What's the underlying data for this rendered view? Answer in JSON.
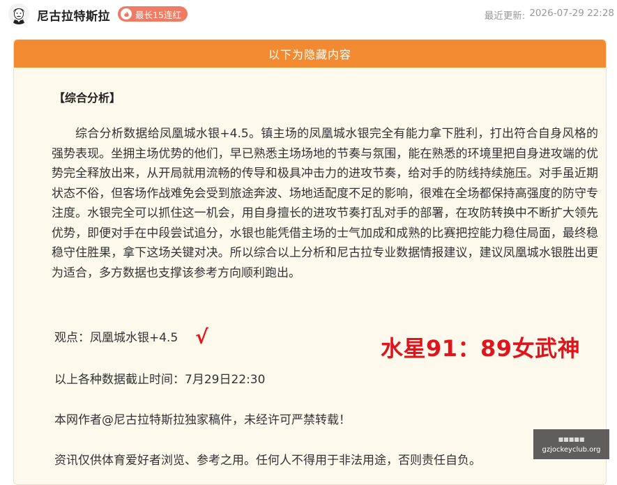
{
  "header": {
    "author_name": "尼古拉特斯拉",
    "streak_badge": "最长15连红",
    "updated_label": "最近更新:",
    "updated_time": "2026-07-29 22:28"
  },
  "card": {
    "hidden_banner": "以下为隐藏内容",
    "section_title": "【综合分析】",
    "analysis_paragraph": "综合分析数据给凤凰城水银+4.5。镇主场的凤凰城水银完全有能力拿下胜利，打出符合自身风格的强势表现。坐拥主场优势的他们，早已熟悉主场场地的节奏与氛围，能在熟悉的环境里把自身进攻端的优势完全释放出来，从开局就用流畅的传导和极具冲击力的进攻节奏，给对手的防线持续施压。对手虽近期状态不俗，但客场作战难免会受到旅途奔波、场地适配度不足的影响，很难在全场都保持高强度的防守专注度。水银完全可以抓住这一机会，用自身擅长的进攻节奏打乱对手的部署，在攻防转换中不断扩大领先优势，即便对手在中段尝试追分，水银也能凭借主场的士气加成和成熟的比赛把控能力稳住局面，最终稳稳守住胜果，拿下这场关键对决。所以综合以上分析和尼古拉专业数据情报建议，建议凤凰城水银胜出更为适合，多方数据也支撑该参考方向顺利跑出。",
    "viewpoint": "观点：凤凰城水银+4.5",
    "check_mark": "√",
    "result_score": "水星91：89女武神",
    "cutoff_time": "以上各种数据截止时间：7月29日22:30",
    "copyright_notice": "本网作者@尼古拉特斯拉独家稿件，未经许可严禁转载！",
    "disclaimer": "资讯仅供体育爱好者浏览、参考之用。任何人不得用于非法用途，否则责任自负。"
  },
  "watermark": {
    "top_text": "■■■■■",
    "domain": "gzjockeyclub.org"
  },
  "colors": {
    "banner": "#f18a31",
    "card_bg": "#fdf9ed",
    "badge": "#ee7b62",
    "result_red": "#e0141b"
  },
  "icons": {
    "avatar": "tesla-portrait-avatar",
    "streak": "flame-icon"
  }
}
